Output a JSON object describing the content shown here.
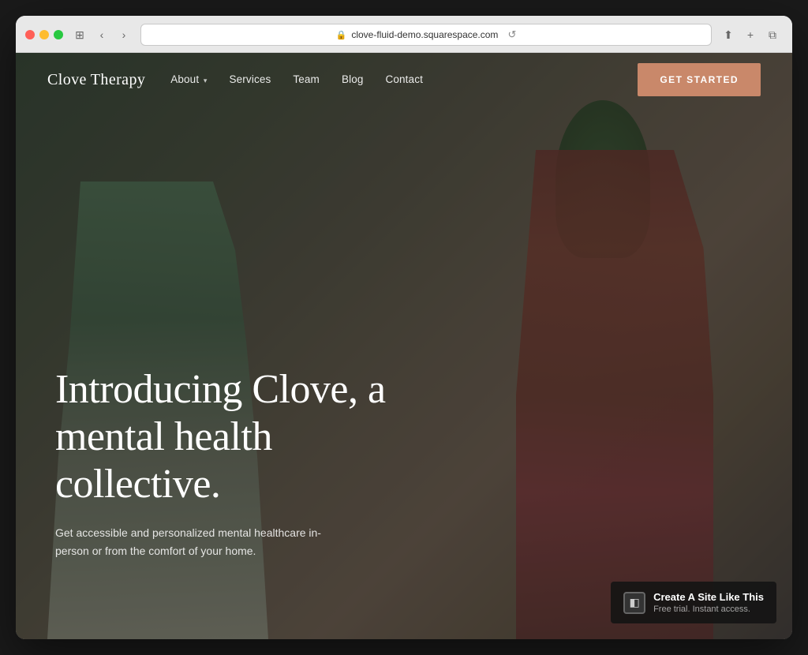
{
  "browser": {
    "url": "clove-fluid-demo.squarespace.com",
    "back_label": "‹",
    "forward_label": "›",
    "refresh_label": "↺",
    "share_label": "⬆",
    "add_tab_label": "+",
    "copy_tab_label": "⧉",
    "grid_label": "⊞"
  },
  "navbar": {
    "brand": "Clove Therapy",
    "links": [
      {
        "label": "About",
        "has_dropdown": true
      },
      {
        "label": "Services"
      },
      {
        "label": "Team"
      },
      {
        "label": "Blog"
      },
      {
        "label": "Contact"
      }
    ],
    "cta_label": "GET STARTED"
  },
  "hero": {
    "title": "Introducing Clove, a mental health collective.",
    "subtitle": "Get accessible and personalized mental healthcare in-person or from the comfort of your home."
  },
  "squarespace_badge": {
    "cta": "Create A Site Like This",
    "sub": "Free trial. Instant access.",
    "icon": "◧"
  },
  "colors": {
    "cta_bg": "#c9886a",
    "brand_color": "#c9886a"
  }
}
